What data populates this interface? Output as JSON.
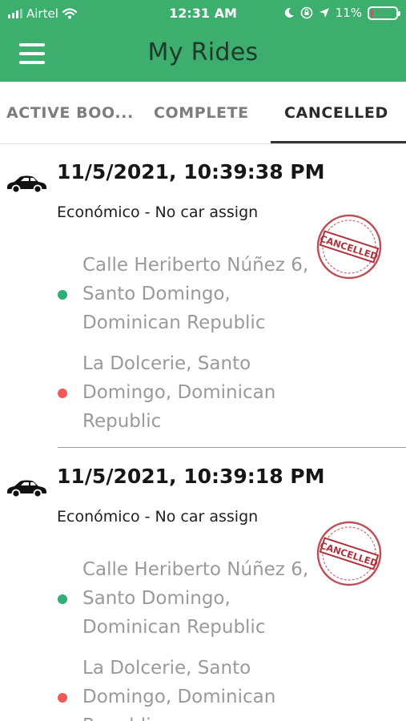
{
  "status_bar": {
    "carrier": "Airtel",
    "time": "12:31 AM",
    "battery": "11%",
    "battery_level": 0.11,
    "icons": [
      "signal-icon",
      "wifi-icon",
      "moon-icon",
      "rotation-lock-icon",
      "location-arrow-icon",
      "battery-icon"
    ]
  },
  "header": {
    "title": "My Rides",
    "menu_icon": "hamburger-menu-icon"
  },
  "tabs": [
    {
      "label": "ACTIVE BOO...",
      "active": false
    },
    {
      "label": "COMPLETE",
      "active": false
    },
    {
      "label": "CANCELLED",
      "active": true
    }
  ],
  "colors": {
    "header_bg": "#3dae6e",
    "pickup_dot": "#2eae74",
    "dropoff_dot": "#ee5a5a",
    "stamp": "#b0303b"
  },
  "rides": [
    {
      "datetime": "11/5/2021, 10:39:38 PM",
      "service": "Económico - No car assign",
      "status_stamp": "CANCELLED",
      "pickup": "Calle Heriberto Núñez 6, Santo Domingo, Dominican Republic",
      "dropoff": "La Dolcerie, Santo Domingo, Dominican Republic"
    },
    {
      "datetime": "11/5/2021, 10:39:18 PM",
      "service": "Económico - No car assign",
      "status_stamp": "CANCELLED",
      "pickup": "Calle Heriberto Núñez 6, Santo Domingo, Dominican Republic",
      "dropoff": "La Dolcerie, Santo Domingo, Dominican Republic"
    }
  ]
}
